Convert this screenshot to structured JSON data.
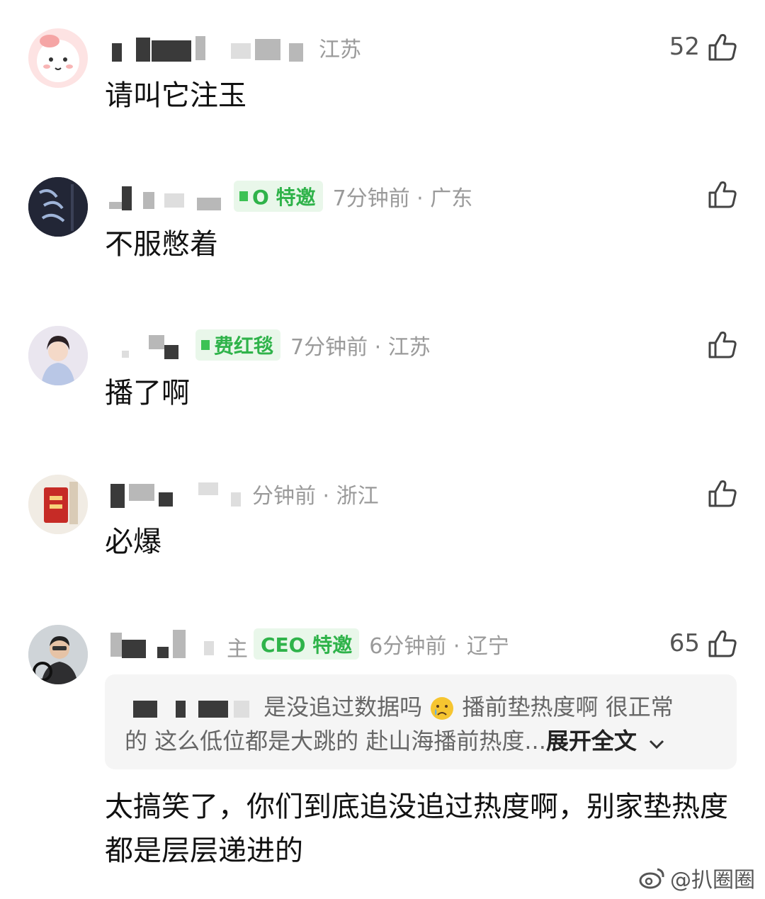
{
  "colors": {
    "badge_text": "#2fb34a",
    "badge_bg": "#e9f7ea",
    "meta_gray": "#9a9a9a"
  },
  "comments": [
    {
      "meta": "江苏",
      "likes": "52",
      "text": "请叫它注玉"
    },
    {
      "badge": "O 特邀",
      "meta": "7分钟前 · 广东",
      "likes": "",
      "text": "不服憋着"
    },
    {
      "badge": "费红毯",
      "meta": "7分钟前 · 江苏",
      "likes": "",
      "text": "播了啊"
    },
    {
      "meta": "分钟前 · 浙江",
      "likes": "",
      "text": "必爆"
    },
    {
      "name_suffix": "主",
      "badge": "CEO 特邀",
      "meta": "6分钟前 · 辽宁",
      "likes": "65",
      "quote": {
        "text": "是没追过数据吗",
        "emoji": "crying-face-icon",
        "text2": "播前垫热度啊 很正常",
        "text3": "的 这么低位都是大跳的 赴山海播前热度...",
        "expand": "展开全文"
      },
      "text": "太搞笑了，你们到底追没追过热度啊，别家垫热度都是层层递进的"
    }
  ],
  "watermark": "@扒圈圈"
}
